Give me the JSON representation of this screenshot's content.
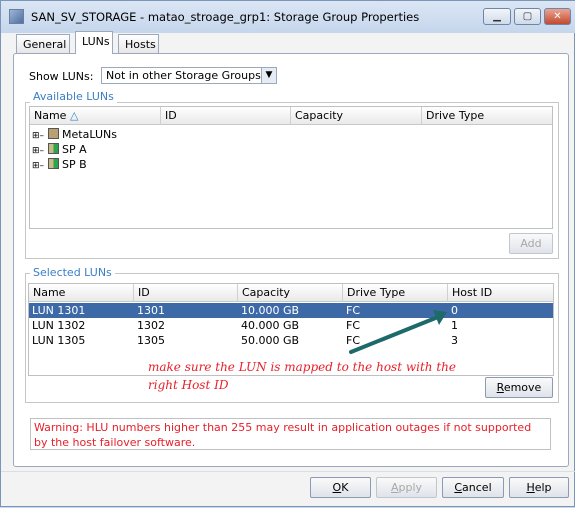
{
  "window": {
    "title": "SAN_SV_STORAGE - matao_stroage_grp1: Storage Group Properties"
  },
  "tabs": [
    {
      "label": "General"
    },
    {
      "label": "LUNs",
      "selected": true
    },
    {
      "label": "Hosts"
    }
  ],
  "show_luns": {
    "label": "Show LUNs:",
    "value": "Not in other Storage Groups"
  },
  "available": {
    "legend": "Available LUNs",
    "columns": [
      "Name",
      "ID",
      "Capacity",
      "Drive Type"
    ],
    "tree": [
      {
        "label": "MetaLUNs",
        "icon": "metalun-icon"
      },
      {
        "label": "SP A",
        "icon": "storage-processor-icon"
      },
      {
        "label": "SP B",
        "icon": "storage-processor-icon"
      }
    ],
    "add_label": "Add"
  },
  "selected": {
    "legend": "Selected LUNs",
    "columns": [
      "Name",
      "ID",
      "Capacity",
      "Drive Type",
      "Host ID"
    ],
    "rows": [
      [
        "LUN 1301",
        "1301",
        "10.000 GB",
        "FC",
        "0"
      ],
      [
        "LUN 1302",
        "1302",
        "40.000 GB",
        "FC",
        "1"
      ],
      [
        "LUN 1305",
        "1305",
        "50.000 GB",
        "FC",
        "3"
      ]
    ],
    "remove_label": "Remove"
  },
  "annotation": {
    "line1": "make sure the LUN is mapped to the host with the",
    "line2": "right Host ID",
    "color": "#e8202a"
  },
  "warning": "Warning: HLU numbers higher than 255 may result in application outages if not supported by the host failover software.",
  "buttons": {
    "ok": "OK",
    "apply": "Apply",
    "cancel": "Cancel",
    "help": "Help"
  }
}
